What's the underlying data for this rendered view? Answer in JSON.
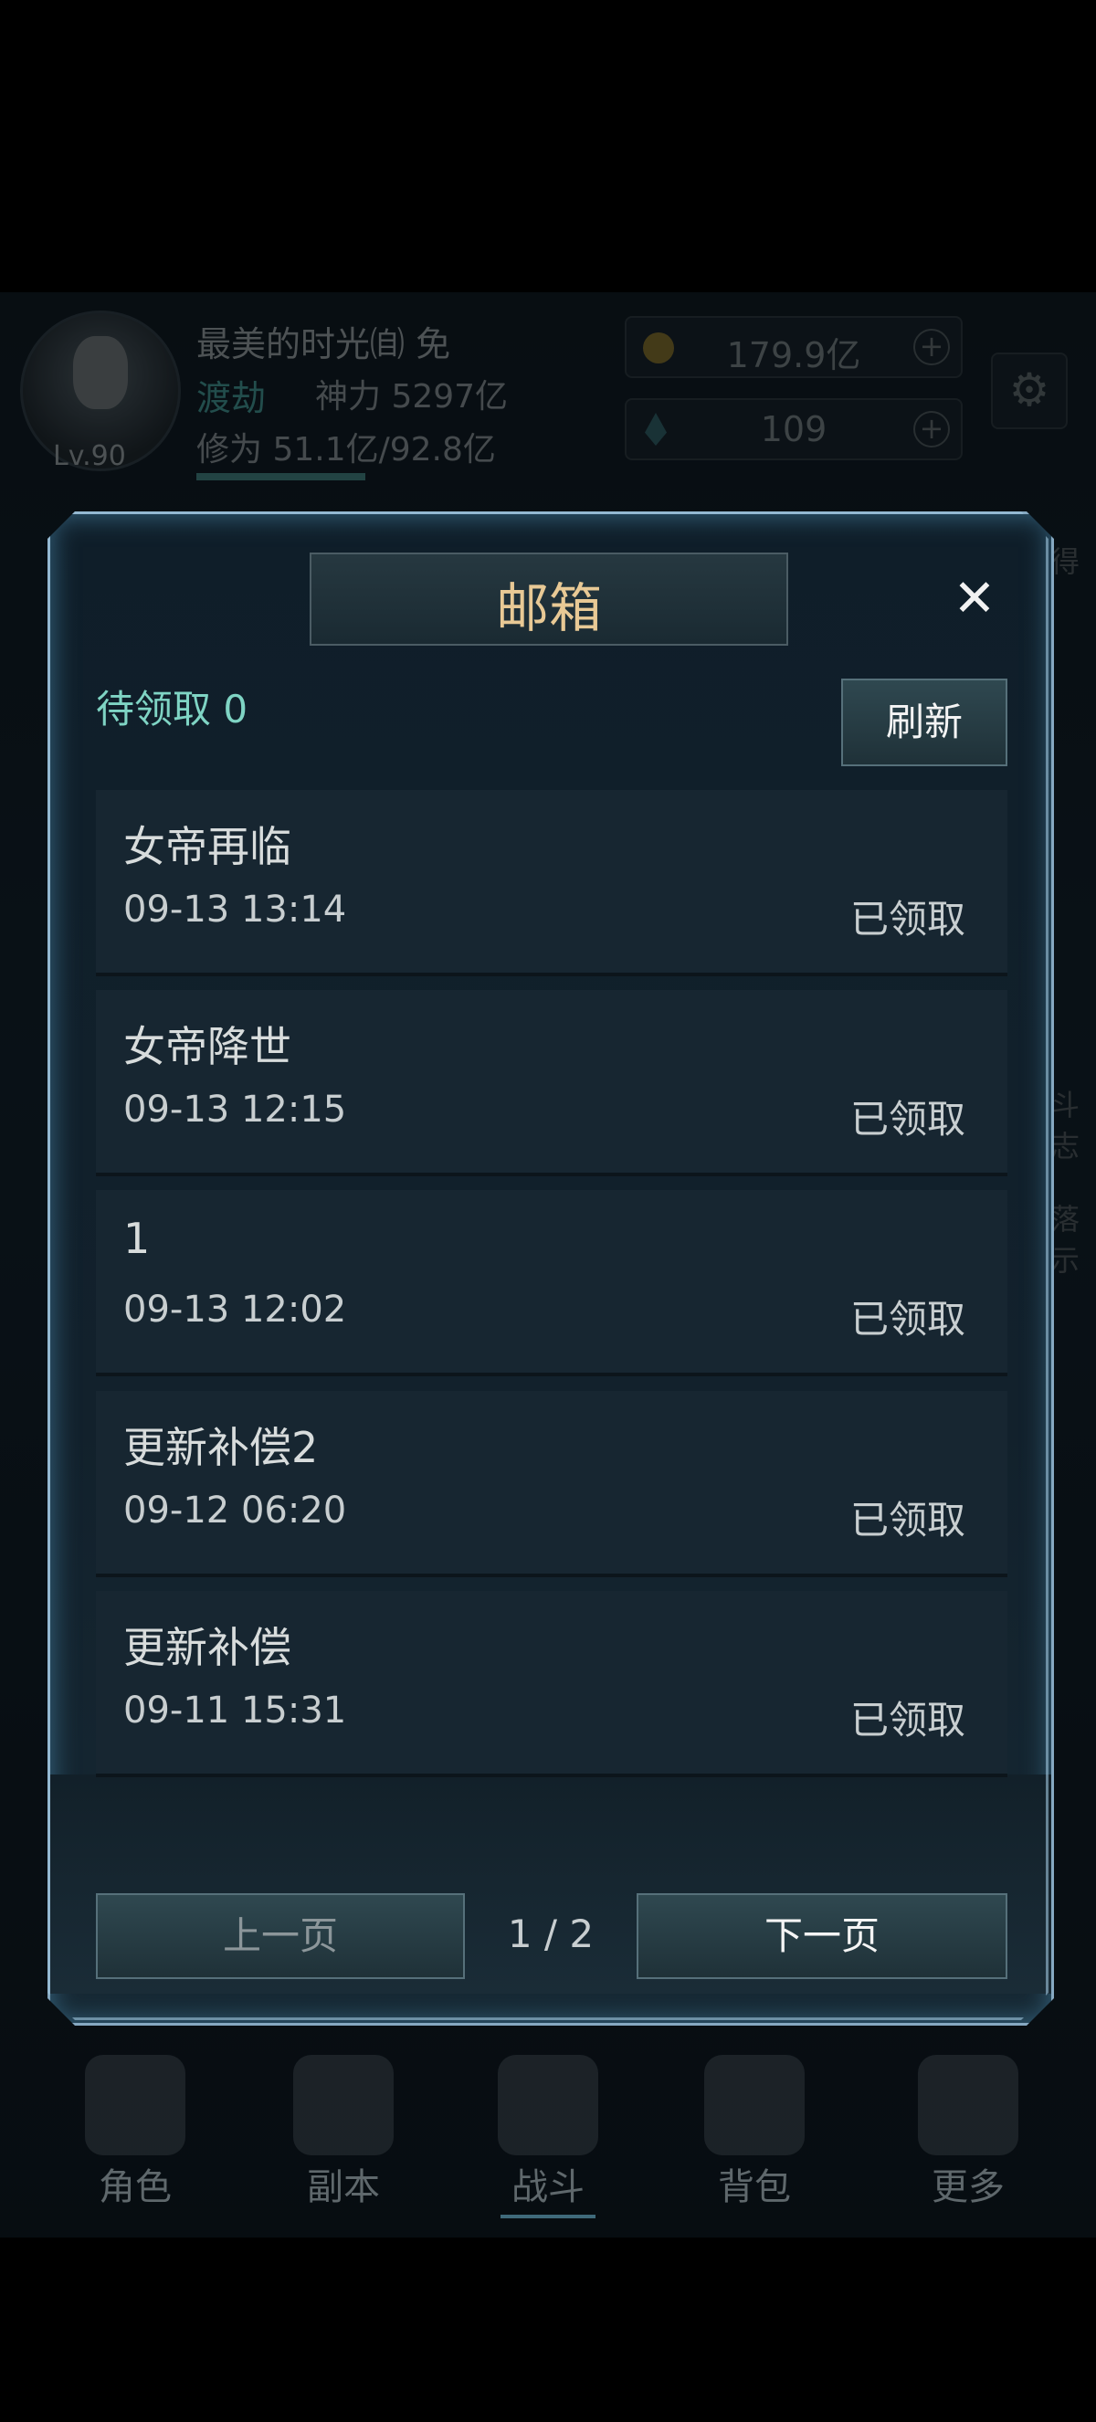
{
  "header": {
    "level": "Lv.90",
    "player_name": "最美的时光㉂ 免",
    "realm": "渡劫",
    "power": "神力 5297亿",
    "cultivation": "修为 51.1亿/92.8亿",
    "gold": "179.9亿",
    "gems": "109",
    "plus_icon": "+",
    "gear_icon": "⚙"
  },
  "side_notes": [
    "得",
    "斗",
    "志",
    "落",
    "示"
  ],
  "mailbox": {
    "title": "邮箱",
    "close_icon": "✕",
    "pending_label": "待领取 0",
    "refresh_label": "刷新",
    "mails": [
      {
        "subject": "女帝再临",
        "time": "09-13 13:14",
        "status": "已领取"
      },
      {
        "subject": "女帝降世",
        "time": "09-13 12:15",
        "status": "已领取"
      },
      {
        "subject": "1",
        "time": "09-13 12:02",
        "status": "已领取"
      },
      {
        "subject": "更新补偿2",
        "time": "09-12 06:20",
        "status": "已领取"
      },
      {
        "subject": "更新补偿",
        "time": "09-11 15:31",
        "status": "已领取"
      }
    ],
    "prev_label": "上一页",
    "page_indicator": "1 / 2",
    "next_label": "下一页"
  },
  "nav": [
    {
      "label": "角色"
    },
    {
      "label": "副本"
    },
    {
      "label": "战斗"
    },
    {
      "label": "背包"
    },
    {
      "label": "更多"
    }
  ]
}
